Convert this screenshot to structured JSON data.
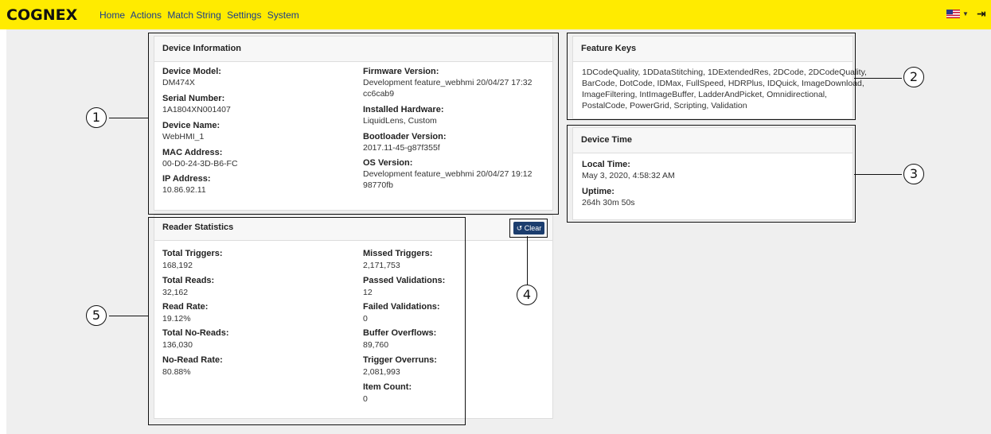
{
  "header": {
    "logo": "COGNEX",
    "nav": [
      "Home",
      "Actions",
      "Match String",
      "Settings",
      "System"
    ],
    "flag_icon": "us-flag-icon",
    "logout_icon": "logout-icon"
  },
  "device_info": {
    "title": "Device Information",
    "left": [
      {
        "label": "Device Model:",
        "value": "DM474X"
      },
      {
        "label": "Serial Number:",
        "value": "1A1804XN001407"
      },
      {
        "label": "Device Name:",
        "value": "WebHMI_1"
      },
      {
        "label": "MAC Address:",
        "value": "00-D0-24-3D-B6-FC"
      },
      {
        "label": "IP Address:",
        "value": "10.86.92.11"
      }
    ],
    "right": [
      {
        "label": "Firmware Version:",
        "value1": "Development feature_webhmi 20/04/27 17:32",
        "value2": "cc6cab9"
      },
      {
        "label": "Installed Hardware:",
        "value1": "LiquidLens, Custom"
      },
      {
        "label": "Bootloader Version:",
        "value1": "2017.11-45-g87f355f"
      },
      {
        "label": "OS Version:",
        "value1": "Development feature_webhmi 20/04/27 19:12",
        "value2": "98770fb"
      }
    ]
  },
  "feature_keys": {
    "title": "Feature Keys",
    "lines": [
      "1DCodeQuality, 1DDataStitching, 1DExtendedRes, 2DCode, 2DCodeQuality,",
      "BarCode, DotCode, IDMax, FullSpeed, HDRPlus, IDQuick, ImageDownload,",
      "ImageFiltering, IntImageBuffer, LadderAndPicket, Omnidirectional,",
      "PostalCode, PowerGrid, Scripting, Validation"
    ]
  },
  "device_time": {
    "title": "Device Time",
    "local_time_label": "Local Time:",
    "local_time": "May 3, 2020, 4:58:32 AM",
    "uptime_label": "Uptime:",
    "uptime": "264h 30m 50s"
  },
  "reader_stats": {
    "title": "Reader Statistics",
    "clear_label": "Clear",
    "left": [
      {
        "label": "Total Triggers:",
        "value": "168,192"
      },
      {
        "label": "Total Reads:",
        "value": "32,162"
      },
      {
        "label": "Read Rate:",
        "value": "19.12%"
      },
      {
        "label": "Total No-Reads:",
        "value": "136,030"
      },
      {
        "label": "No-Read Rate:",
        "value": "80.88%"
      }
    ],
    "right": [
      {
        "label": "Missed Triggers:",
        "value": "2,171,753"
      },
      {
        "label": "Passed Validations:",
        "value": "12"
      },
      {
        "label": "Failed Validations:",
        "value": "0"
      },
      {
        "label": "Buffer Overflows:",
        "value": "89,760"
      },
      {
        "label": "Trigger Overruns:",
        "value": "2,081,993"
      },
      {
        "label": "Item Count:",
        "value": "0"
      }
    ]
  },
  "callouts": [
    "1",
    "2",
    "3",
    "4",
    "5"
  ]
}
